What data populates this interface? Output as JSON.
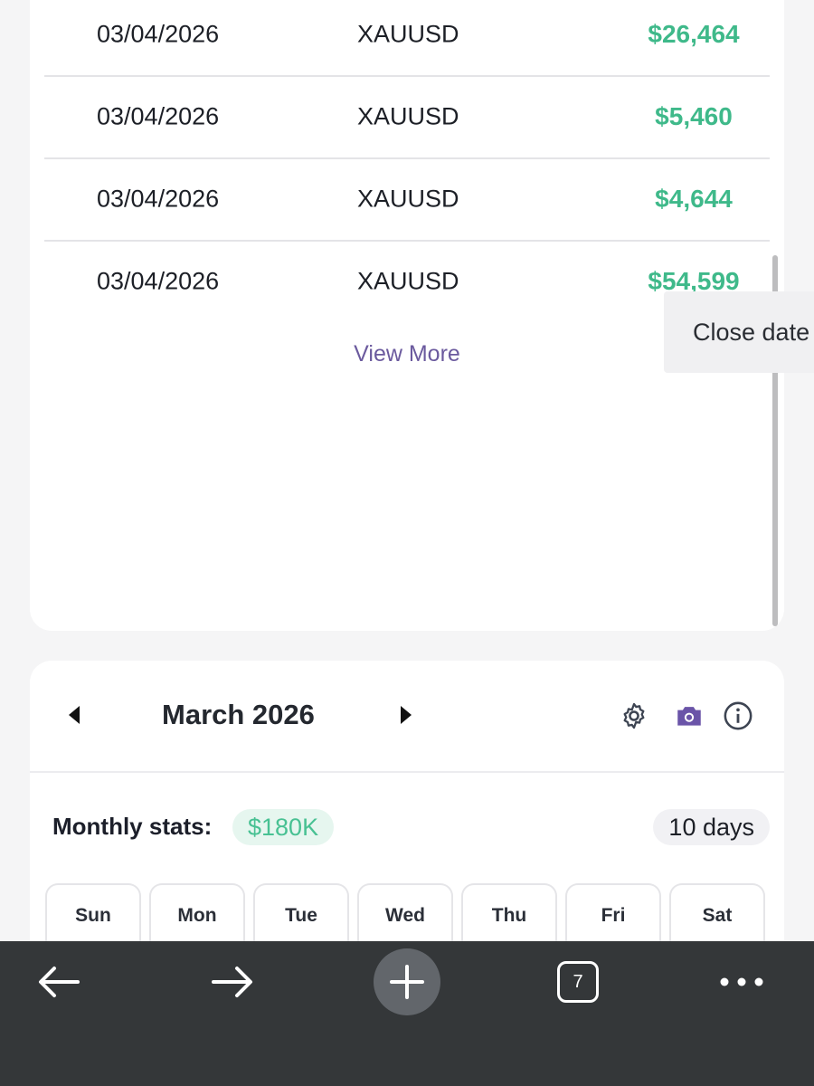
{
  "trades": {
    "rows": [
      {
        "date": "03/04/2026",
        "symbol": "XAUUSD",
        "pnl": "$26,464"
      },
      {
        "date": "03/04/2026",
        "symbol": "XAUUSD",
        "pnl": "$5,460"
      },
      {
        "date": "03/04/2026",
        "symbol": "XAUUSD",
        "pnl": "$4,644"
      },
      {
        "date": "03/04/2026",
        "symbol": "XAUUSD",
        "pnl": "$54,599"
      }
    ],
    "view_more_label": "View More",
    "tooltip_text": "Close date"
  },
  "calendar": {
    "month_label": "March 2026",
    "icons": [
      "gear-icon",
      "camera-icon",
      "info-icon"
    ],
    "stats_label": "Monthly stats:",
    "stats_value": "$180K",
    "days_label": "10 days",
    "weekdays": [
      "Sun",
      "Mon",
      "Tue",
      "Wed",
      "Thu",
      "Fri",
      "Sat"
    ]
  },
  "bottom_bar": {
    "tab_count": "7",
    "icons": [
      "back-arrow-icon",
      "forward-arrow-icon",
      "new-tab-plus-icon",
      "tabs-icon",
      "more-options-icon"
    ]
  },
  "colors": {
    "profit": "#3fb98a",
    "accent": "#6b5a9e",
    "bar": "#343739"
  }
}
